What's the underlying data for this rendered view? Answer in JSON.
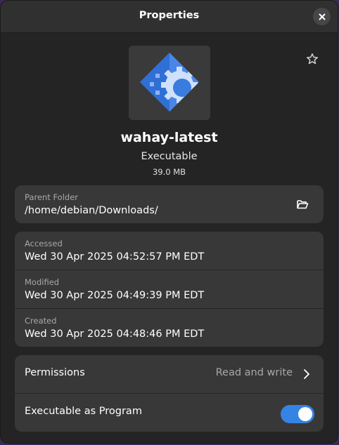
{
  "window": {
    "title": "Properties"
  },
  "file": {
    "name": "wahay-latest",
    "type": "Executable",
    "size": "39.0 MB"
  },
  "parent_folder": {
    "label": "Parent Folder",
    "path": "/home/debian/Downloads/"
  },
  "dates": [
    {
      "label": "Accessed",
      "value": "Wed 30 Apr 2025 04:52:57 PM EDT"
    },
    {
      "label": "Modified",
      "value": "Wed 30 Apr 2025 04:49:39 PM EDT"
    },
    {
      "label": "Created",
      "value": "Wed 30 Apr 2025 04:48:46 PM EDT"
    }
  ],
  "permissions": {
    "label": "Permissions",
    "value": "Read and write"
  },
  "executable": {
    "label": "Executable as Program",
    "enabled": true
  },
  "icons": {
    "close": "close-icon",
    "star": "star-icon",
    "file": "executable-gear-icon",
    "open_folder": "open-folder-icon",
    "chevron": "chevron-right-icon"
  },
  "colors": {
    "accent": "#3584e4",
    "window_bg": "#242424",
    "card_bg": "#383838"
  }
}
